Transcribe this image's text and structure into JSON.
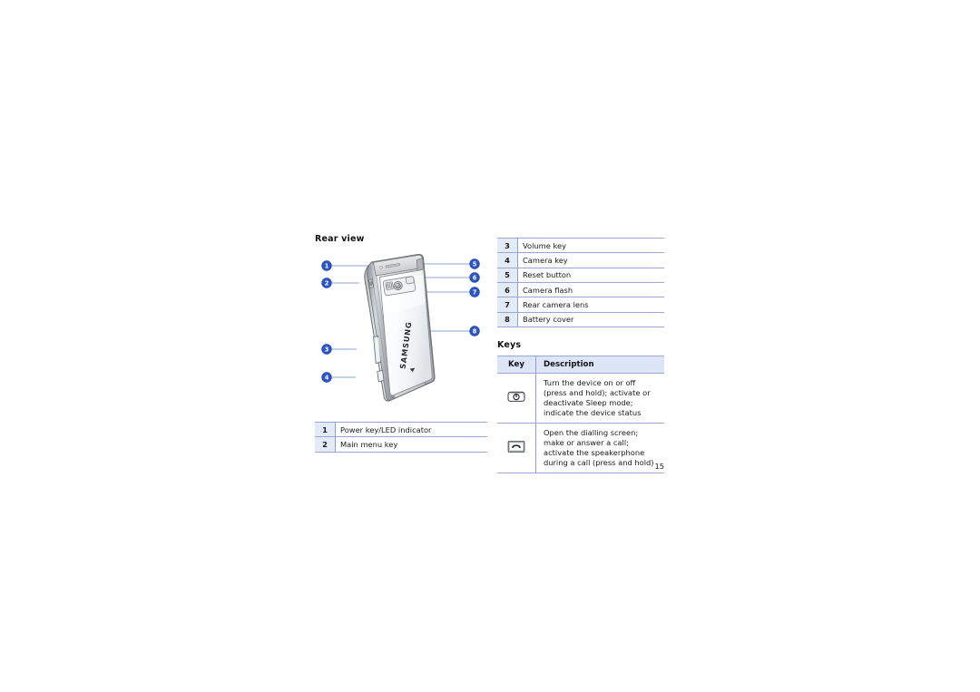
{
  "page": {
    "number": "15"
  },
  "left_section": {
    "heading": "Rear view",
    "illustration": {
      "name": "samsung-phone-rear-view",
      "brand_text": "SAMSUNG",
      "callouts": [
        "1",
        "2",
        "3",
        "4",
        "5",
        "6",
        "7",
        "8"
      ]
    },
    "table": {
      "rows": [
        {
          "num": "1",
          "label": "Power key/LED indicator"
        },
        {
          "num": "2",
          "label": "Main menu key"
        }
      ]
    }
  },
  "right_section": {
    "table": {
      "rows": [
        {
          "num": "3",
          "label": "Volume key"
        },
        {
          "num": "4",
          "label": "Camera key"
        },
        {
          "num": "5",
          "label": "Reset button"
        },
        {
          "num": "6",
          "label": "Camera flash"
        },
        {
          "num": "7",
          "label": "Rear camera lens"
        },
        {
          "num": "8",
          "label": "Battery cover"
        }
      ]
    },
    "keys": {
      "heading": "Keys",
      "header": {
        "key": "Key",
        "description": "Description"
      },
      "rows": [
        {
          "icon": "power-key-icon",
          "lines": [
            "Turn the device on or off",
            "(press and hold); activate or",
            "deactivate Sleep mode;",
            "indicate the device status"
          ]
        },
        {
          "icon": "call-key-icon",
          "lines": [
            "Open the dialling screen;",
            "make or answer a call;",
            "activate the speakerphone",
            "during a call (press and hold)"
          ]
        }
      ]
    }
  },
  "colors": {
    "callout_blue": "#2a56c6",
    "table_border": "#9aa7d4",
    "key_cell_bg": "#e3ebf7",
    "header_bg": "#dce6f6",
    "leader_line": "#8ea4d8"
  }
}
